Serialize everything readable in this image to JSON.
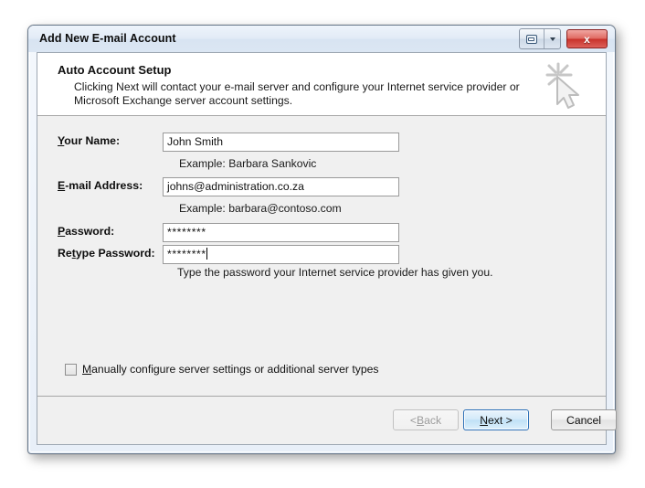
{
  "window": {
    "title": "Add New E-mail Account",
    "controls": {
      "restore_label": "restore-window",
      "dropdown_label": "window-menu",
      "close_label": "x"
    }
  },
  "header": {
    "title": "Auto Account Setup",
    "description": "Clicking Next will contact your e-mail server and configure your Internet service provider or Microsoft Exchange server account settings.",
    "icon": "cursor-sparkle-icon"
  },
  "form": {
    "name": {
      "label_pre": "",
      "label_accel": "Y",
      "label_post": "our Name:",
      "value": "John Smith",
      "hint": "Example: Barbara Sankovic"
    },
    "email": {
      "label_pre": "",
      "label_accel": "E",
      "label_post": "-mail Address:",
      "value": "johns@administration.co.za",
      "hint": "Example: barbara@contoso.com"
    },
    "password": {
      "label_pre": "",
      "label_accel": "P",
      "label_post": "assword:",
      "value": "********"
    },
    "retype": {
      "label_pre": "Re",
      "label_accel": "t",
      "label_post": "ype Password:",
      "value": "********"
    },
    "password_hint": "Type the password your Internet service provider has given you."
  },
  "manual": {
    "checked": false,
    "label_pre": "",
    "label_accel": "M",
    "label_post": "anually configure server settings or additional server types"
  },
  "footer": {
    "back": {
      "pre": "< ",
      "accel": "B",
      "post": "ack",
      "disabled": true
    },
    "next": {
      "pre": "",
      "accel": "N",
      "post": "ext >",
      "default": true
    },
    "cancel": {
      "label": "Cancel"
    }
  },
  "colors": {
    "accent_blue": "#2c70b8",
    "close_red": "#c8312a",
    "dialog_bg": "#f0f0f0",
    "header_bg": "#ffffff"
  }
}
